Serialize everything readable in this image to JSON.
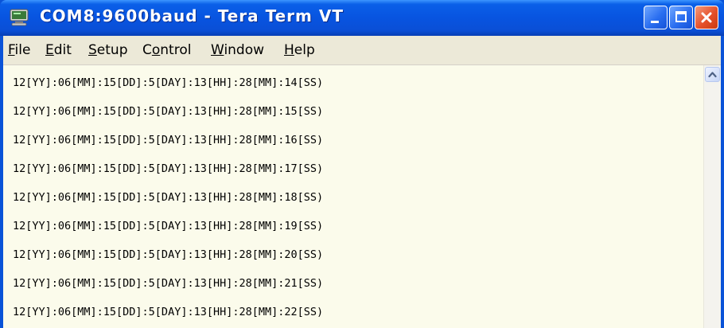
{
  "window": {
    "title": "COM8:9600baud - Tera Term VT",
    "app_icon": "tera-term-icon",
    "controls": {
      "minimize_icon": "minimize-icon",
      "maximize_icon": "maximize-icon",
      "close_icon": "close-icon"
    }
  },
  "menu": {
    "items": [
      {
        "label": "File",
        "accel": "F",
        "rest": "ile"
      },
      {
        "label": "Edit",
        "accel": "E",
        "rest": "dit"
      },
      {
        "label": "Setup",
        "accel": "S",
        "rest": "etup"
      },
      {
        "label": "Control",
        "pre": "C",
        "accel": "o",
        "rest": "ntrol"
      },
      {
        "label": "Window",
        "accel": "W",
        "rest": "indow"
      },
      {
        "label": "Help",
        "accel": "H",
        "rest": "elp"
      }
    ]
  },
  "terminal": {
    "background": "#fbfbeb",
    "lines": [
      "12[YY]:06[MM]:15[DD]:5[DAY]:13[HH]:28[MM]:14[SS)",
      "12[YY]:06[MM]:15[DD]:5[DAY]:13[HH]:28[MM]:15[SS)",
      "12[YY]:06[MM]:15[DD]:5[DAY]:13[HH]:28[MM]:16[SS)",
      "12[YY]:06[MM]:15[DD]:5[DAY]:13[HH]:28[MM]:17[SS)",
      "12[YY]:06[MM]:15[DD]:5[DAY]:13[HH]:28[MM]:18[SS)",
      "12[YY]:06[MM]:15[DD]:5[DAY]:13[HH]:28[MM]:19[SS)",
      "12[YY]:06[MM]:15[DD]:5[DAY]:13[HH]:28[MM]:20[SS)",
      "12[YY]:06[MM]:15[DD]:5[DAY]:13[HH]:28[MM]:21[SS)",
      "12[YY]:06[MM]:15[DD]:5[DAY]:13[HH]:28[MM]:22[SS)"
    ]
  },
  "scrollbar": {
    "up_icon": "scroll-up-arrow-icon"
  }
}
